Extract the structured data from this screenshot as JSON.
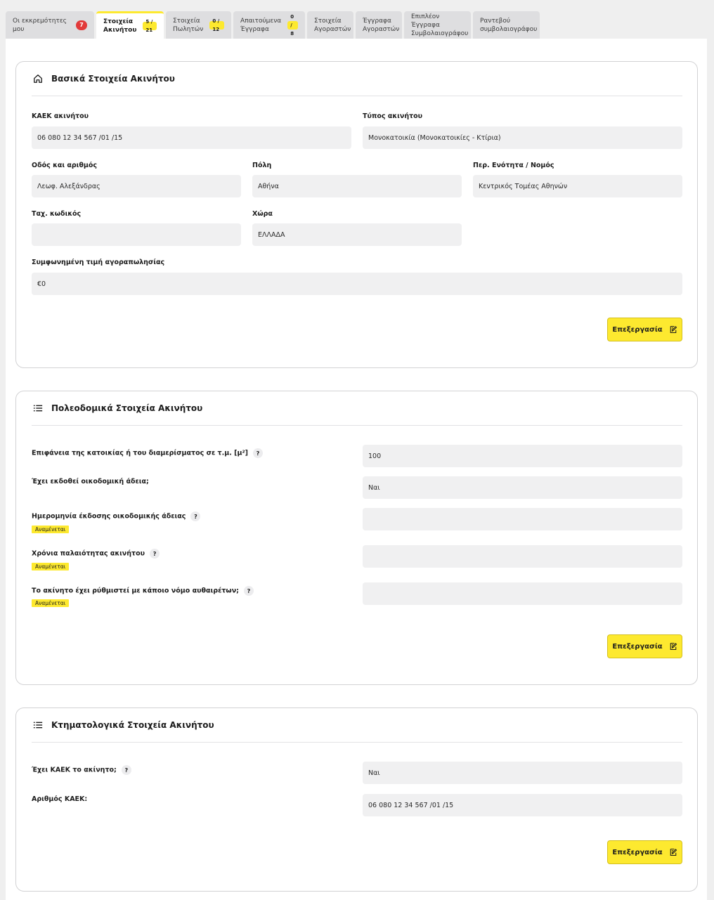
{
  "tabs": [
    {
      "label": "Οι εκκρεμότητες μου",
      "badge": "7",
      "badge_type": "red"
    },
    {
      "label": "Στοιχεία\nΑκινήτου",
      "badge": "5 / 21",
      "badge_type": "yellow",
      "active": true
    },
    {
      "label": "Στοιχεία\nΠωλητών",
      "badge": "0 / 12",
      "badge_type": "yellow"
    },
    {
      "label": "Απαιτούμενα\nΈγγραφα",
      "badge": "0 / 8",
      "badge_type": "yellow"
    },
    {
      "label": "Στοιχεία\nΑγοραστών"
    },
    {
      "label": "Έγγραφα\nΑγοραστών"
    },
    {
      "label": "Επιπλέον Έγγραφα\nΣυμβολαιογράφου"
    },
    {
      "label": "Ραντεβού\nσυμβολαιογράφου"
    }
  ],
  "basic": {
    "title": "Βασικά Στοιχεία Ακινήτου",
    "icon": "home-icon",
    "kaek_label": "ΚΑΕΚ ακινήτου",
    "kaek_value": "06 080 12 34 567 /01 /15",
    "type_label": "Τύπος ακινήτου",
    "type_value": "Μονοκατοικία (Μονοκατοικίες - Κτίρια)",
    "street_label": "Οδός και αριθμός",
    "street_value": "Λεωφ. Αλεξάνδρας",
    "city_label": "Πόλη",
    "city_value": "Αθήνα",
    "region_label": "Περ. Ενότητα / Νομός",
    "region_value": "Κεντρικός Τομέας Αθηνών",
    "zip_label": "Ταχ. κωδικός",
    "zip_value": "",
    "country_label": "Χώρα",
    "country_value": "ΕΛΛΑΔΑ",
    "price_label": "Συμφωνημένη τιμή αγοραπωλησίας",
    "price_value": "€0",
    "edit_label": "Επεξεργασία"
  },
  "urban": {
    "title": "Πολεοδομικά Στοιχεία Ακινήτου",
    "icon": "list-icon",
    "area_label": "Επιφάνεια της κατοικίας ή του διαμερίσματος σε τ.μ. [μ²]",
    "area_value": "100",
    "permit_label": "Έχει εκδοθεί οικοδομική άδεια;",
    "permit_value": "Ναι",
    "permit_date_label": "Ημερομηνία έκδοσης οικοδομικής άδειας",
    "permit_date_value": "",
    "age_label": "Χρόνια παλαιότητας ακινήτου",
    "age_value": "",
    "illegal_label": "Το ακίνητο έχει ρύθμιστεί με κάποιο νόμο αυθαιρέτων;",
    "illegal_value": "",
    "pending_label": "Αναμένεται",
    "help": "?",
    "edit_label": "Επεξεργασία"
  },
  "cadastral": {
    "title": "Κτηματολογικά Στοιχεία Ακινήτου",
    "icon": "list-icon",
    "has_kaek_label": "Έχει ΚΑΕΚ το ακίνητο;",
    "has_kaek_value": "Ναι",
    "kaek_num_label": "Αριθμός ΚΑΕΚ:",
    "kaek_num_value": "06 080 12 34 567 /01 /15",
    "help": "?",
    "edit_label": "Επεξεργασία"
  }
}
